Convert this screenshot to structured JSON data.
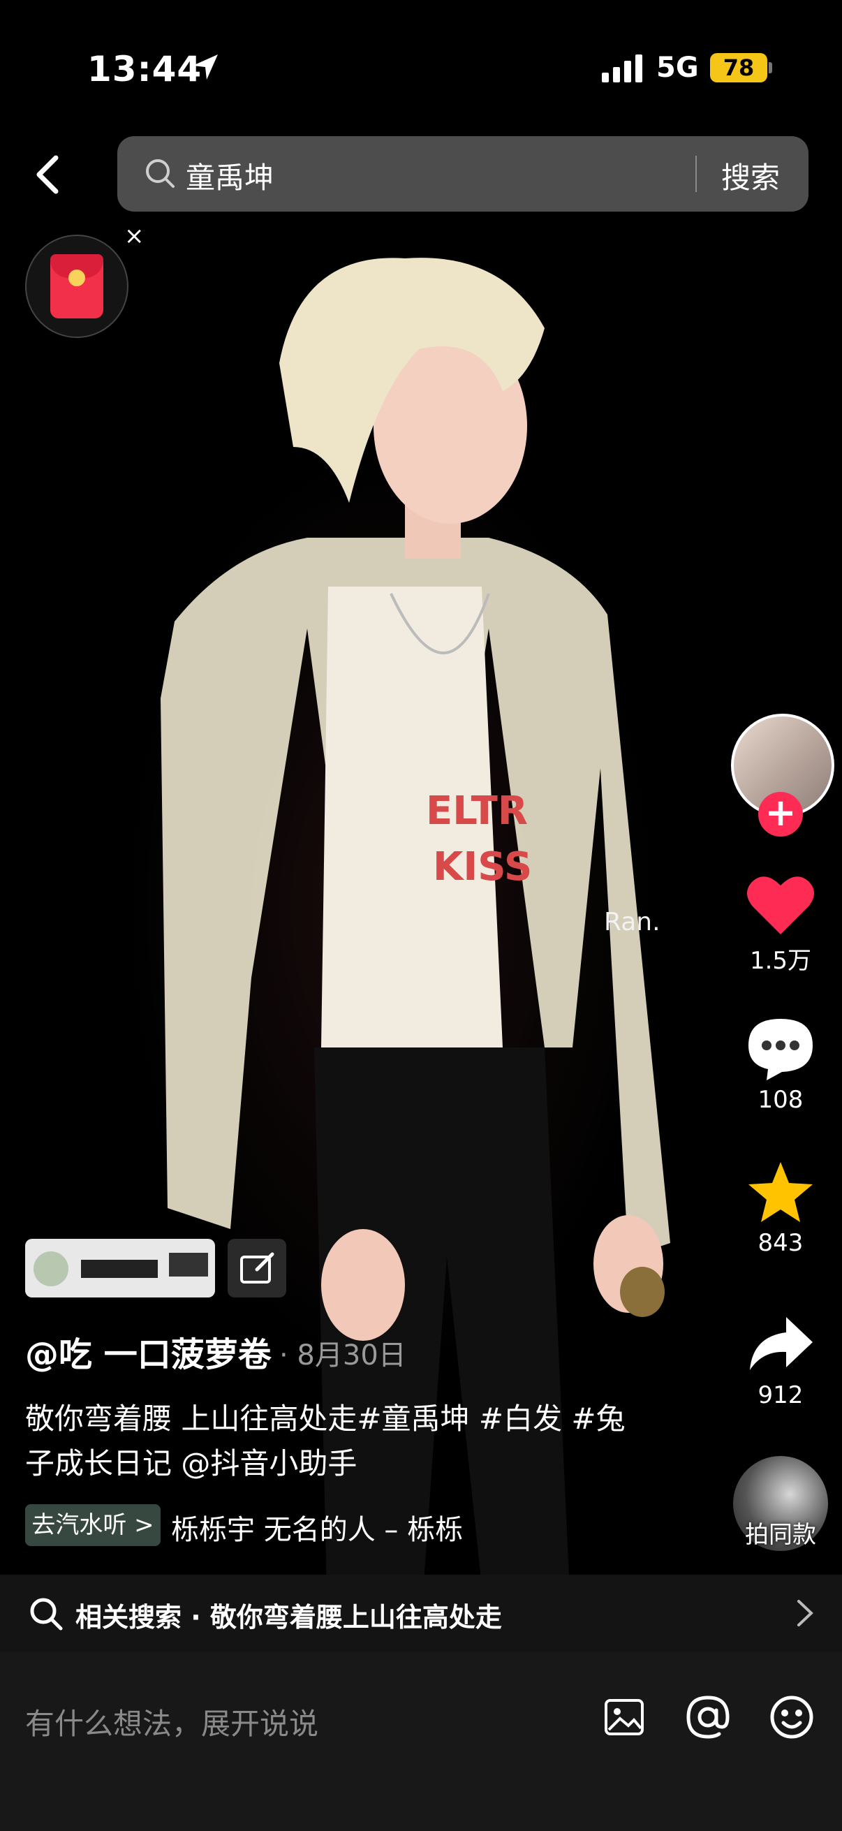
{
  "status_bar": {
    "time": "13:44",
    "network": "5G",
    "battery": "78"
  },
  "search": {
    "query": "童禹坤",
    "button": "搜索"
  },
  "red_packet": {
    "close": "×"
  },
  "video": {
    "watermark": "Ran."
  },
  "actions": {
    "likes": "1.5万",
    "comments": "108",
    "favorites": "843",
    "shares": "912",
    "same_style": "拍同款",
    "follow": "+"
  },
  "post": {
    "author": "@吃 一口菠萝卷",
    "date": "· 8月30日",
    "description": "敬你弯着腰 上山往高处走#童禹坤 #白发 #兔子成长日记 @抖音小助手",
    "music_button": "去汽水听 >",
    "music": "栎栎宇  无名的人 – 栎栎"
  },
  "related": {
    "text": "相关搜索 · 敬你弯着腰上山往高处走"
  },
  "comment": {
    "placeholder": "有什么想法，展开说说"
  },
  "colors": {
    "like": "#fe2c55",
    "favorite": "#ffc300",
    "battery": "#f5c518"
  }
}
